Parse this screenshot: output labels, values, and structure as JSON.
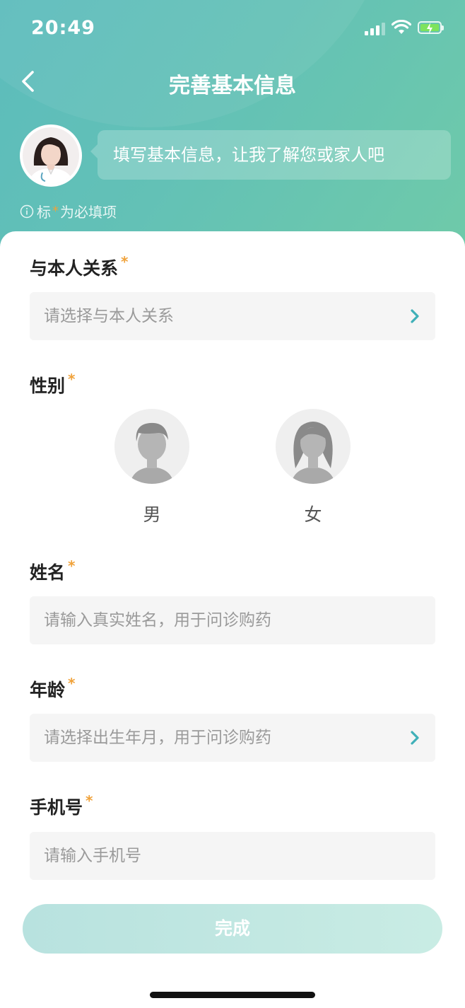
{
  "status_bar": {
    "time": "20:49"
  },
  "nav": {
    "title": "完善基本信息"
  },
  "assistant": {
    "message": "填写基本信息，让我了解您或家人吧"
  },
  "hint": {
    "prefix": "标",
    "suffix": "为必填项"
  },
  "form": {
    "relation": {
      "label": "与本人关系",
      "placeholder": "请选择与本人关系"
    },
    "gender": {
      "label": "性别",
      "male": "男",
      "female": "女"
    },
    "name": {
      "label": "姓名",
      "placeholder": "请输入真实姓名，用于问诊购药"
    },
    "age": {
      "label": "年龄",
      "placeholder": "请选择出生年月，用于问诊购药"
    },
    "phone": {
      "label": "手机号",
      "placeholder": "请输入手机号"
    },
    "required_mark": "*"
  },
  "submit": {
    "label": "完成"
  },
  "colors": {
    "accent": "#4db6b6",
    "required": "#f0a23a",
    "header_start": "#5cbcbc",
    "header_end": "#6fcaa9"
  }
}
